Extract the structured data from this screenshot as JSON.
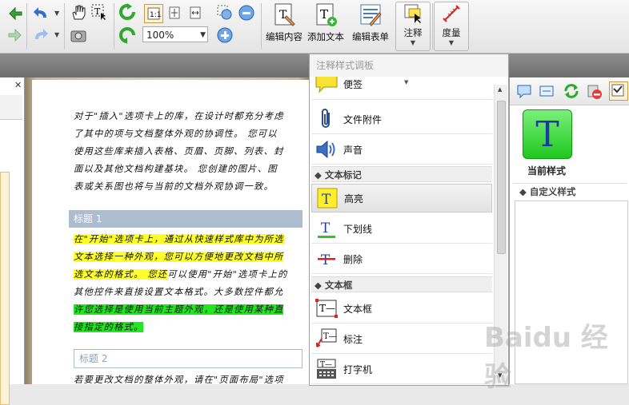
{
  "toolbar": {
    "zoom_value": "100%",
    "buttons": {
      "edit_content": "编辑内容",
      "add_text": "添加文本",
      "edit_form": "编辑表单",
      "annotate": "注释",
      "measure": "度量"
    }
  },
  "palette": {
    "title": "注释样式调板",
    "items": [
      {
        "label": "便签",
        "icon": "sticky-note-icon"
      },
      {
        "label": "文件附件",
        "icon": "paperclip-icon"
      },
      {
        "label": "声音",
        "icon": "speaker-icon"
      }
    ],
    "cat_text_markup": "文本标记",
    "markup_items": [
      {
        "label": "高亮",
        "icon": "highlight-icon"
      },
      {
        "label": "下划线",
        "icon": "underline-icon"
      },
      {
        "label": "删除",
        "icon": "strikeout-icon"
      }
    ],
    "cat_textbox": "文本框",
    "textbox_items": [
      {
        "label": "文本框",
        "icon": "textbox-icon"
      },
      {
        "label": "标注",
        "icon": "callout-icon"
      },
      {
        "label": "打字机",
        "icon": "typewriter-icon"
      }
    ]
  },
  "right_panel": {
    "current_style_label": "当前样式",
    "tile_letter": "T",
    "custom_style_label": "自定义样式"
  },
  "document": {
    "para1": [
      "对于\"插入\"选项卡上的库，在设计时都充分考虑",
      "了其中的项与文档整体外观的协调性。 您可以",
      "使用这些库来插入表格、页眉、页脚、列表、封",
      "面以及其他文档构建基块。 您创建的图片、图",
      "表或关系图也将与当前的文档外观协调一致。"
    ],
    "heading1": "标题 1",
    "para2": [
      {
        "text": "在\"开始\"选项卡上，通过从快速样式库中为所选",
        "hl": "y"
      },
      {
        "text": "文本选择一种外观，您可以方便地更改文档中所",
        "hl": "y"
      },
      {
        "text": "选文本的格式。 您还",
        "hl": "y",
        "rest": "可以使用\"开始\"选项卡上的"
      },
      {
        "text": "",
        "hl": "",
        "rest": "其他控件来直接设置文本格式。大多数控件都允"
      },
      {
        "text": "许您选择是使用当前主题外观，还是使用某种直",
        "hl": "g"
      },
      {
        "text": "接指定的格式。",
        "hl": "g"
      }
    ],
    "heading2": "标题 2",
    "para3": "若要更改文档的整体外观，请在\"页面布局\"选项"
  },
  "watermark": "Baidu 经验",
  "colors": {
    "highlight_yellow": "#ffff2a",
    "highlight_green": "#22e622",
    "style_tile": "#2ed62e"
  }
}
